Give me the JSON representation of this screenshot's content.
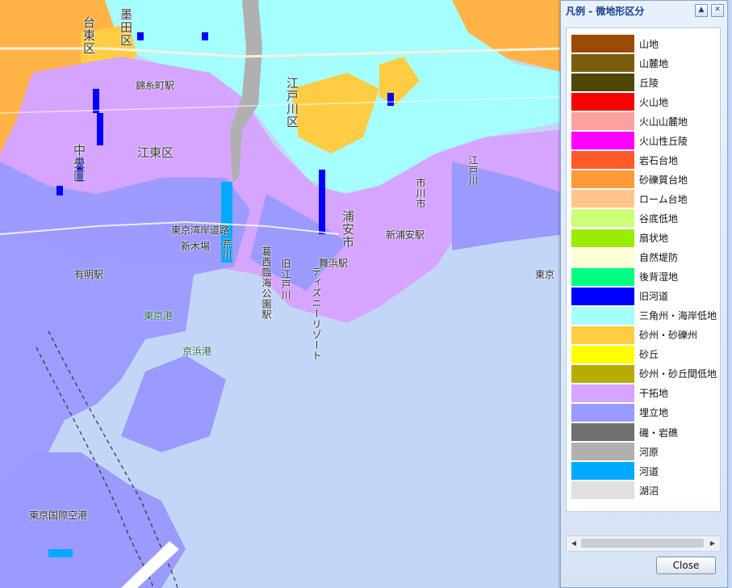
{
  "legend": {
    "title": "凡例 - 微地形区分",
    "minimize_icon": "▲",
    "close_icon": "✕",
    "close_button_label": "Close",
    "scroll_left_icon": "◀",
    "scroll_right_icon": "▶",
    "items": [
      {
        "label": "山地",
        "color": "#9c4a05"
      },
      {
        "label": "山麓地",
        "color": "#7b5e0d"
      },
      {
        "label": "丘陵",
        "color": "#4e4705"
      },
      {
        "label": "火山地",
        "color": "#ff0000"
      },
      {
        "label": "火山山麓地",
        "color": "#ffa0a0"
      },
      {
        "label": "火山性丘陵",
        "color": "#ff00ff"
      },
      {
        "label": "岩石台地",
        "color": "#ff5a2a"
      },
      {
        "label": "砂礫質台地",
        "color": "#ff9a3a"
      },
      {
        "label": "ローム台地",
        "color": "#ffc58a"
      },
      {
        "label": "谷底低地",
        "color": "#ccff77"
      },
      {
        "label": "扇状地",
        "color": "#99ee00"
      },
      {
        "label": "自然堤防",
        "color": "#ffffd5"
      },
      {
        "label": "後背湿地",
        "color": "#00ff80"
      },
      {
        "label": "旧河道",
        "color": "#0000ff"
      },
      {
        "label": "三角州・海岸低地",
        "color": "#a5ffff"
      },
      {
        "label": "砂州・砂礫州",
        "color": "#ffcc44"
      },
      {
        "label": "砂丘",
        "color": "#ffff00"
      },
      {
        "label": "砂州・砂丘間低地",
        "color": "#b5ad05"
      },
      {
        "label": "干拓地",
        "color": "#d5a5ff"
      },
      {
        "label": "埋立地",
        "color": "#9a9aff"
      },
      {
        "label": "磯・岩礁",
        "color": "#707070"
      },
      {
        "label": "河原",
        "color": "#b0b0b0"
      },
      {
        "label": "河道",
        "color": "#00aaff"
      },
      {
        "label": "湖沼",
        "color": "#e0e0e0"
      }
    ]
  },
  "map": {
    "labels": {
      "koto_ku": "江東区",
      "edogawa_ku": "江戸川区",
      "urayasu_shi": "浦安市",
      "ichikawa_shi": "市川市",
      "chuo_ku": "中央区",
      "sumida_ku": "墨田区",
      "taito_ku": "台東区",
      "kinshicho": "錦糸町駅",
      "tokyo_port": "東京港",
      "keihin_port": "京浜港",
      "haneda": "東京国際空港",
      "kasai_park": "葛西臨海公園駅",
      "old_edogawa": "旧江戸川",
      "disney": "ディズニーリゾート",
      "shin_urayasu": "新浦安駅",
      "maihama": "舞浜駅",
      "wangan": "東京湾岸道路",
      "arakawa": "荒川",
      "edogawa_river": "江戸川",
      "shinkiba": "新木場",
      "ariake": "有明駅",
      "tokyo_right": "東京"
    }
  }
}
